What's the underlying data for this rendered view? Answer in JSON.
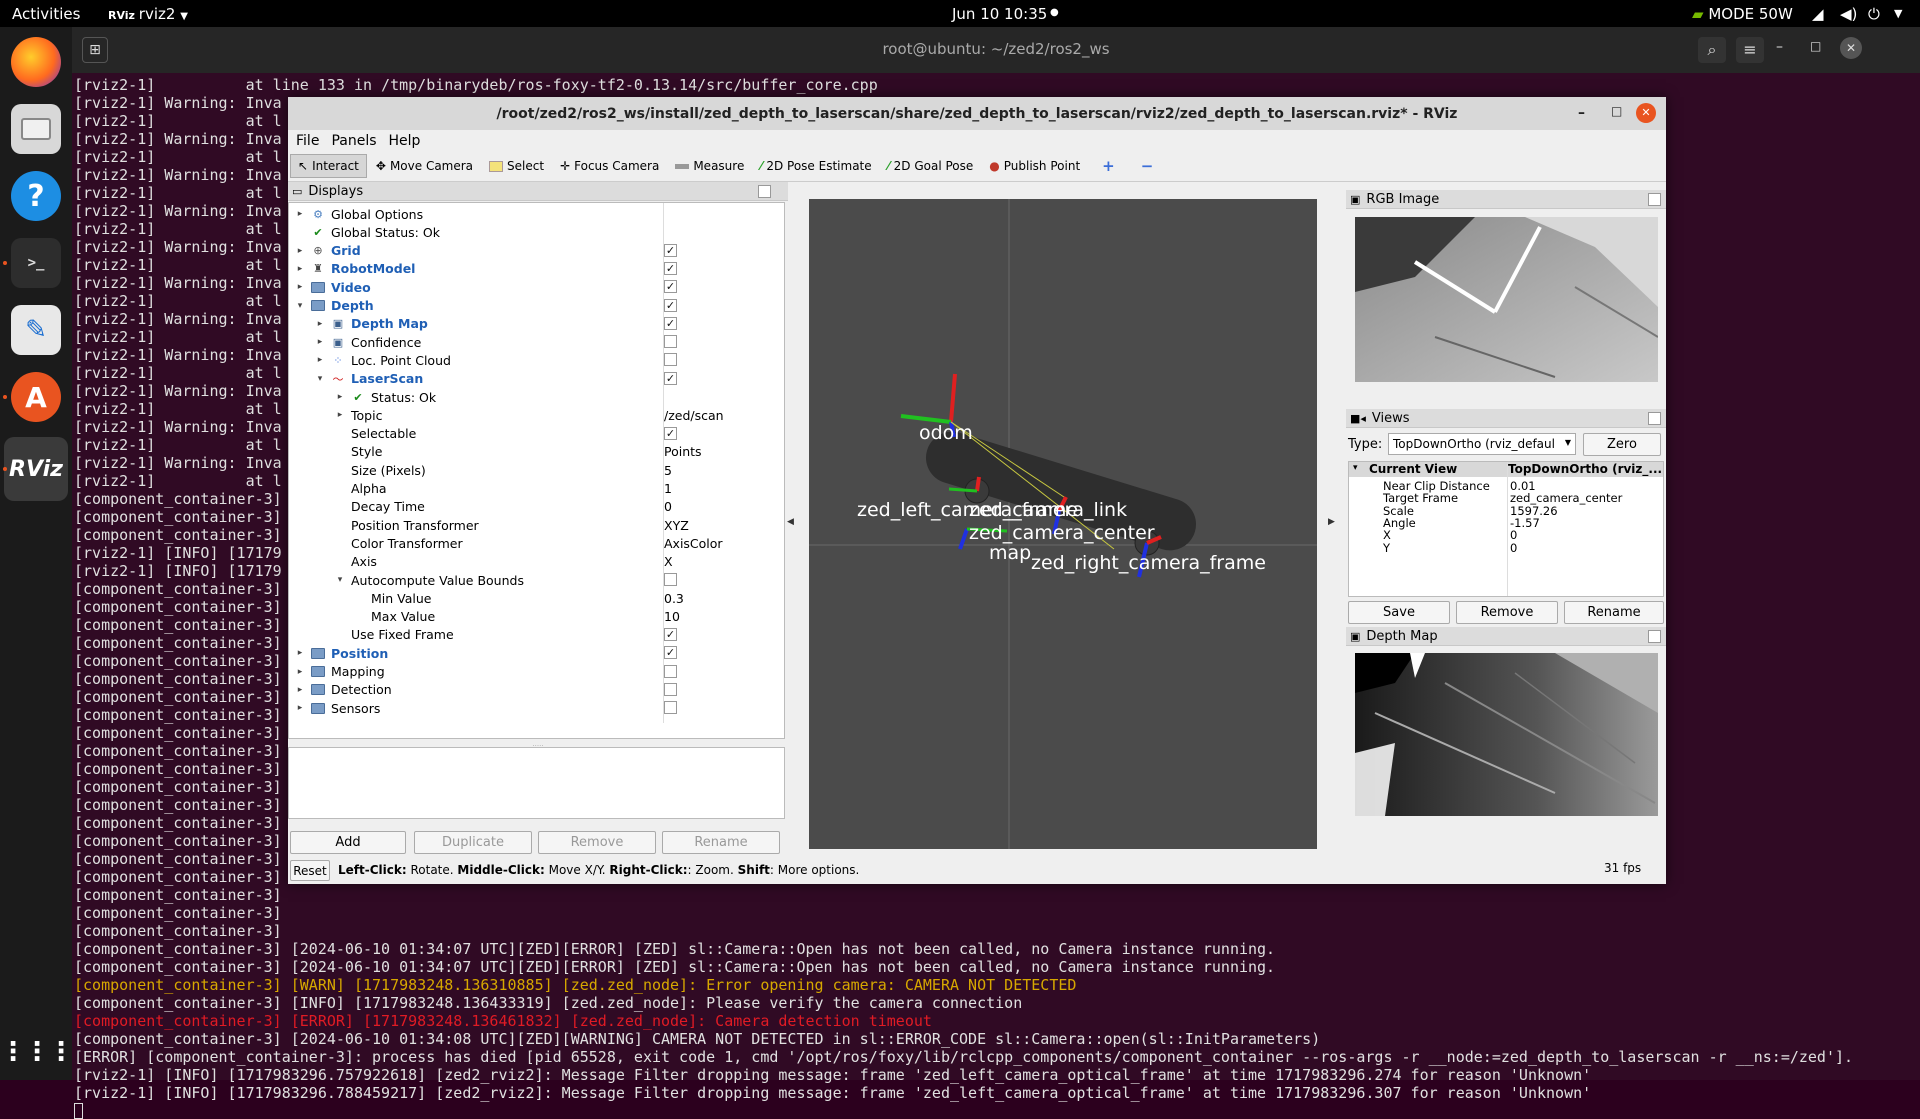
{
  "topbar": {
    "activities": "Activities",
    "app": "rviz2",
    "datetime": "Jun 10  10:35",
    "power_mode": "MODE 50W"
  },
  "dock": {
    "items": [
      "firefox-icon",
      "files-icon",
      "help-icon",
      "terminal-icon",
      "text-editor-icon",
      "software-icon",
      "rviz-icon",
      "app-grid-icon"
    ],
    "rviz_label": "RViz"
  },
  "terminal": {
    "title": "root@ubuntu: ~/zed2/ros2_ws",
    "lines": [
      {
        "t": "[rviz2-1]          at line 133 in /tmp/binarydeb/ros-foxy-tf2-0.13.14/src/buffer_core.cpp",
        "c": ""
      },
      {
        "t": "[rviz2-1] Warning: Inva",
        "c": ""
      },
      {
        "t": "[rviz2-1]          at l",
        "c": ""
      },
      {
        "t": "[rviz2-1] Warning: Inva",
        "c": ""
      },
      {
        "t": "[rviz2-1]          at l",
        "c": ""
      },
      {
        "t": "[rviz2-1] Warning: Inva",
        "c": ""
      },
      {
        "t": "[rviz2-1]          at l",
        "c": ""
      },
      {
        "t": "[rviz2-1] Warning: Inva",
        "c": ""
      },
      {
        "t": "[rviz2-1]          at l",
        "c": ""
      },
      {
        "t": "[rviz2-1] Warning: Inva",
        "c": ""
      },
      {
        "t": "[rviz2-1]          at l",
        "c": ""
      },
      {
        "t": "[rviz2-1] Warning: Inva",
        "c": ""
      },
      {
        "t": "[rviz2-1]          at l",
        "c": ""
      },
      {
        "t": "[rviz2-1] Warning: Inva",
        "c": ""
      },
      {
        "t": "[rviz2-1]          at l",
        "c": ""
      },
      {
        "t": "[rviz2-1] Warning: Inva",
        "c": ""
      },
      {
        "t": "[rviz2-1]          at l",
        "c": ""
      },
      {
        "t": "[rviz2-1] Warning: Inva",
        "c": ""
      },
      {
        "t": "[rviz2-1]          at l",
        "c": ""
      },
      {
        "t": "[rviz2-1] Warning: Inva",
        "c": ""
      },
      {
        "t": "[rviz2-1]          at l",
        "c": ""
      },
      {
        "t": "[rviz2-1] Warning: Inva",
        "c": ""
      },
      {
        "t": "[rviz2-1]          at l",
        "c": ""
      },
      {
        "t": "[component_container-3]",
        "c": ""
      },
      {
        "t": "[component_container-3]",
        "c": ""
      },
      {
        "t": "[component_container-3]",
        "c": ""
      },
      {
        "t": "[rviz2-1] [INFO] [17179",
        "c": ""
      },
      {
        "t": "[rviz2-1] [INFO] [17179",
        "c": ""
      },
      {
        "t": "[component_container-3]",
        "c": ""
      },
      {
        "t": "[component_container-3]",
        "c": ""
      },
      {
        "t": "[component_container-3]",
        "c": ""
      },
      {
        "t": "[component_container-3]",
        "c": ""
      },
      {
        "t": "[component_container-3]",
        "c": ""
      },
      {
        "t": "[component_container-3]",
        "c": ""
      },
      {
        "t": "[component_container-3]",
        "c": ""
      },
      {
        "t": "[component_container-3]",
        "c": ""
      },
      {
        "t": "[component_container-3]",
        "c": ""
      },
      {
        "t": "[component_container-3]",
        "c": ""
      },
      {
        "t": "[component_container-3]",
        "c": ""
      },
      {
        "t": "[component_container-3]",
        "c": ""
      },
      {
        "t": "[component_container-3]",
        "c": ""
      },
      {
        "t": "[component_container-3]",
        "c": ""
      },
      {
        "t": "[component_container-3]",
        "c": ""
      },
      {
        "t": "[component_container-3]",
        "c": ""
      },
      {
        "t": "[component_container-3]",
        "c": ""
      },
      {
        "t": "[component_container-3]",
        "c": ""
      },
      {
        "t": "[component_container-3]",
        "c": ""
      },
      {
        "t": "[component_container-3]",
        "c": ""
      },
      {
        "t": "[component_container-3] [2024-06-10 01:34:07 UTC][ZED][ERROR] [ZED] sl::Camera::Open has not been called, no Camera instance running.",
        "c": ""
      },
      {
        "t": "[component_container-3] [2024-06-10 01:34:07 UTC][ZED][ERROR] [ZED] sl::Camera::Open has not been called, no Camera instance running.",
        "c": ""
      },
      {
        "t": "[component_container-3] [WARN] [1717983248.136310885] [zed.zed_node]: Error opening camera: CAMERA NOT DETECTED",
        "c": "warn"
      },
      {
        "t": "[component_container-3] [INFO] [1717983248.136433319] [zed.zed_node]: Please verify the camera connection",
        "c": ""
      },
      {
        "t": "[component_container-3] [ERROR] [1717983248.136461832] [zed.zed_node]: Camera detection timeout",
        "c": "err"
      },
      {
        "t": "[component_container-3] [2024-06-10 01:34:08 UTC][ZED][WARNING] CAMERA NOT DETECTED in sl::ERROR_CODE sl::Camera::open(sl::InitParameters)",
        "c": ""
      },
      {
        "t": "[ERROR] [component_container-3]: process has died [pid 65528, exit code 1, cmd '/opt/ros/foxy/lib/rclcpp_components/component_container --ros-args -r __node:=zed_depth_to_laserscan -r __ns:=/zed'].",
        "c": ""
      },
      {
        "t": "[rviz2-1] [INFO] [1717983296.757922618] [zed2_rviz2]: Message Filter dropping message: frame 'zed_left_camera_optical_frame' at time 1717983296.274 for reason 'Unknown'",
        "c": ""
      },
      {
        "t": "[rviz2-1] [INFO] [1717983296.788459217] [zed2_rviz2]: Message Filter dropping message: frame 'zed_left_camera_optical_frame' at time 1717983296.307 for reason 'Unknown'",
        "c": ""
      }
    ]
  },
  "rviz": {
    "title": "/root/zed2/ros2_ws/install/zed_depth_to_laserscan/share/zed_depth_to_laserscan/rviz2/zed_depth_to_laserscan.rviz* - RViz",
    "menu": [
      "File",
      "Panels",
      "Help"
    ],
    "tools": [
      {
        "label": "Interact",
        "icon": "cursor-icon"
      },
      {
        "label": "Move Camera",
        "icon": "move-camera-icon"
      },
      {
        "label": "Select",
        "icon": "select-icon"
      },
      {
        "label": "Focus Camera",
        "icon": "focus-camera-icon"
      },
      {
        "label": "Measure",
        "icon": "ruler-icon"
      },
      {
        "label": "2D Pose Estimate",
        "icon": "green-arrow-icon"
      },
      {
        "label": "2D Goal Pose",
        "icon": "green-arrow-icon"
      },
      {
        "label": "Publish Point",
        "icon": "pin-icon"
      }
    ],
    "displays": {
      "title": "Displays",
      "rows": [
        {
          "label": "Global Options",
          "indent": 0,
          "arrow": "▸",
          "icon": "gear",
          "bold": false
        },
        {
          "label": "Global Status: Ok",
          "indent": 0,
          "arrow": "",
          "icon": "check",
          "bold": false
        },
        {
          "label": "Grid",
          "indent": 0,
          "arrow": "▸",
          "icon": "grid",
          "bold": true,
          "checked": true
        },
        {
          "label": "RobotModel",
          "indent": 0,
          "arrow": "▸",
          "icon": "robot",
          "bold": true,
          "checked": true
        },
        {
          "label": "Video",
          "indent": 0,
          "arrow": "▸",
          "icon": "folder",
          "bold": true,
          "checked": true
        },
        {
          "label": "Depth",
          "indent": 0,
          "arrow": "▾",
          "icon": "folder",
          "bold": true,
          "checked": true
        },
        {
          "label": "Depth Map",
          "indent": 1,
          "arrow": "▸",
          "icon": "image",
          "bold": true,
          "checked": true
        },
        {
          "label": "Confidence",
          "indent": 1,
          "arrow": "▸",
          "icon": "image",
          "bold": false,
          "checked": false
        },
        {
          "label": "Loc. Point Cloud",
          "indent": 1,
          "arrow": "▸",
          "icon": "cloud",
          "bold": false,
          "checked": false
        },
        {
          "label": "LaserScan",
          "indent": 1,
          "arrow": "▾",
          "icon": "laser",
          "bold": true,
          "checked": true
        },
        {
          "label": "Status: Ok",
          "indent": 2,
          "arrow": "▸",
          "icon": "check",
          "bold": false
        },
        {
          "label": "Topic",
          "indent": 2,
          "arrow": "▸",
          "icon": "",
          "bold": false,
          "value": "/zed/scan"
        },
        {
          "label": "Selectable",
          "indent": 2,
          "arrow": "",
          "icon": "",
          "bold": false,
          "checked": true
        },
        {
          "label": "Style",
          "indent": 2,
          "arrow": "",
          "icon": "",
          "bold": false,
          "value": "Points"
        },
        {
          "label": "Size (Pixels)",
          "indent": 2,
          "arrow": "",
          "icon": "",
          "bold": false,
          "value": "5"
        },
        {
          "label": "Alpha",
          "indent": 2,
          "arrow": "",
          "icon": "",
          "bold": false,
          "value": "1"
        },
        {
          "label": "Decay Time",
          "indent": 2,
          "arrow": "",
          "icon": "",
          "bold": false,
          "value": "0"
        },
        {
          "label": "Position Transformer",
          "indent": 2,
          "arrow": "",
          "icon": "",
          "bold": false,
          "value": "XYZ"
        },
        {
          "label": "Color Transformer",
          "indent": 2,
          "arrow": "",
          "icon": "",
          "bold": false,
          "value": "AxisColor"
        },
        {
          "label": "Axis",
          "indent": 2,
          "arrow": "",
          "icon": "",
          "bold": false,
          "value": "X"
        },
        {
          "label": "Autocompute Value Bounds",
          "indent": 2,
          "arrow": "▾",
          "icon": "",
          "bold": false,
          "checked": false
        },
        {
          "label": "Min Value",
          "indent": 3,
          "arrow": "",
          "icon": "",
          "bold": false,
          "value": "0.3"
        },
        {
          "label": "Max Value",
          "indent": 3,
          "arrow": "",
          "icon": "",
          "bold": false,
          "value": "10"
        },
        {
          "label": "Use Fixed Frame",
          "indent": 2,
          "arrow": "",
          "icon": "",
          "bold": false,
          "checked": true
        },
        {
          "label": "Position",
          "indent": 0,
          "arrow": "▸",
          "icon": "folder",
          "bold": true,
          "checked": true
        },
        {
          "label": "Mapping",
          "indent": 0,
          "arrow": "▸",
          "icon": "folder",
          "bold": false,
          "checked": false
        },
        {
          "label": "Detection",
          "indent": 0,
          "arrow": "▸",
          "icon": "folder",
          "bold": false,
          "checked": false
        },
        {
          "label": "Sensors",
          "indent": 0,
          "arrow": "▸",
          "icon": "folder",
          "bold": false,
          "checked": false
        }
      ],
      "buttons": {
        "add": "Add",
        "duplicate": "Duplicate",
        "remove": "Remove",
        "rename": "Rename"
      }
    },
    "view3d": {
      "frames": [
        "odom",
        "zed_left_camera_frame",
        "zed_camera_link",
        "zed_camera_center",
        "map",
        "zed_right_camera_frame"
      ]
    },
    "rgb_panel": {
      "title": "RGB Image"
    },
    "views_panel": {
      "title": "Views",
      "type_label": "Type:",
      "type_value": "TopDownOrtho (rviz_defaul",
      "zero": "Zero",
      "header_name": "Current View",
      "header_value": "TopDownOrtho (rviz_...",
      "props": [
        {
          "name": "Near Clip Distance",
          "value": "0.01"
        },
        {
          "name": "Target Frame",
          "value": "zed_camera_center"
        },
        {
          "name": "Scale",
          "value": "1597.26"
        },
        {
          "name": "Angle",
          "value": "-1.57"
        },
        {
          "name": "X",
          "value": "0"
        },
        {
          "name": "Y",
          "value": "0"
        }
      ],
      "save": "Save",
      "remove": "Remove",
      "rename": "Rename"
    },
    "depth_panel": {
      "title": "Depth Map"
    },
    "status": {
      "reset": "Reset",
      "left_click": "Left-Click:",
      "left_desc": " Rotate. ",
      "middle_click": "Middle-Click:",
      "middle_desc": " Move X/Y. ",
      "right_click": "Right-Click:",
      "right_desc": ": Zoom. ",
      "shift": "Shift",
      "shift_desc": ": More options.",
      "fps": "31 fps"
    }
  }
}
